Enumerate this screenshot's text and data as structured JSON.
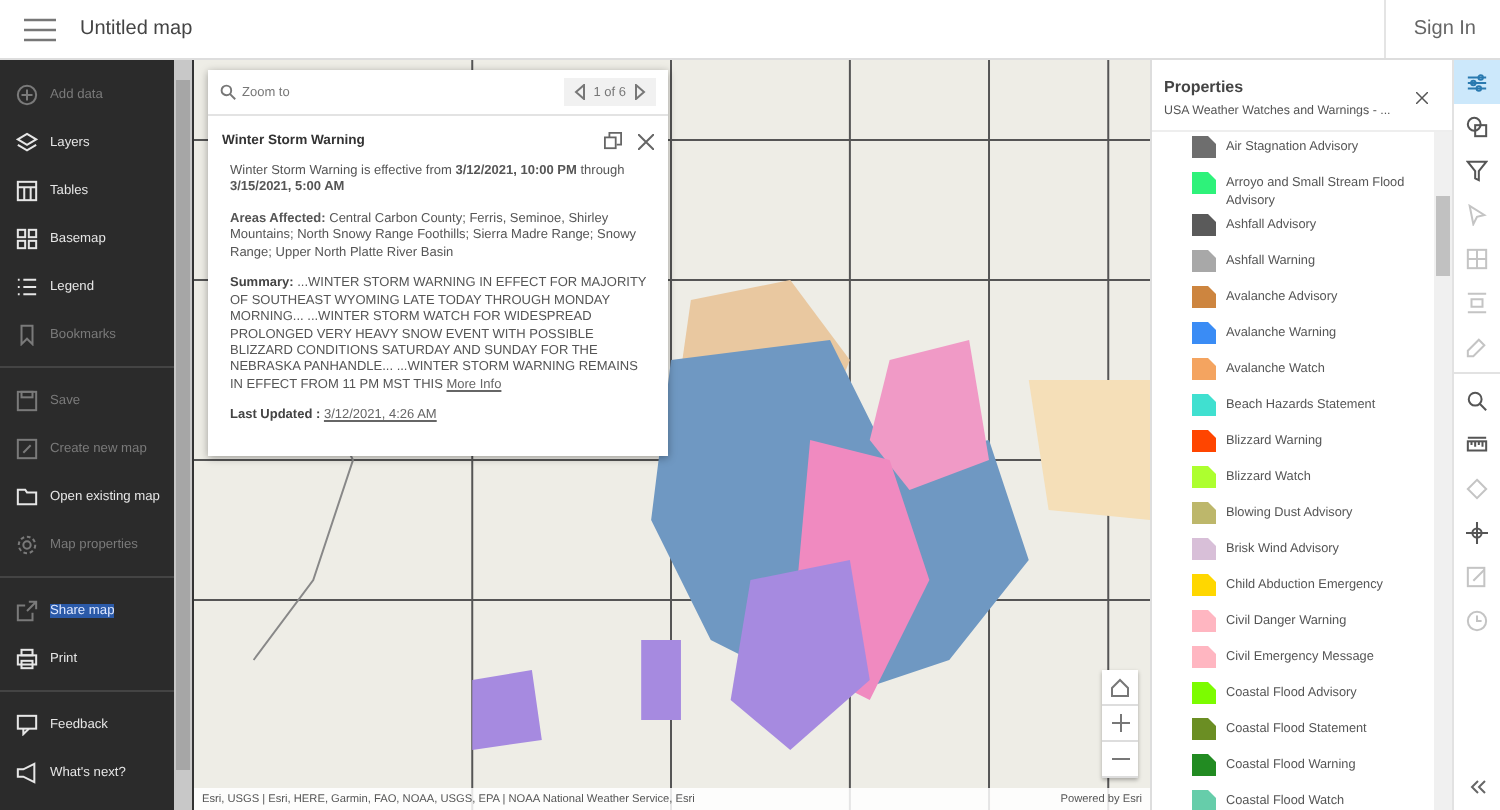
{
  "header": {
    "title": "Untitled map",
    "sign_in": "Sign In"
  },
  "sidebar": {
    "groups": [
      [
        {
          "label": "Add data",
          "kind": "plus-circle",
          "enabled": false,
          "highlighted": false
        },
        {
          "label": "Layers",
          "kind": "layers",
          "enabled": true,
          "highlighted": false
        },
        {
          "label": "Tables",
          "kind": "table",
          "enabled": true,
          "highlighted": false
        },
        {
          "label": "Basemap",
          "kind": "grid",
          "enabled": true,
          "highlighted": false
        },
        {
          "label": "Legend",
          "kind": "list",
          "enabled": true,
          "highlighted": false
        },
        {
          "label": "Bookmarks",
          "kind": "bookmark",
          "enabled": false,
          "highlighted": false
        }
      ],
      [
        {
          "label": "Save",
          "kind": "save",
          "enabled": false,
          "highlighted": false
        },
        {
          "label": "Create new map",
          "kind": "new",
          "enabled": false,
          "highlighted": false
        },
        {
          "label": "Open existing map",
          "kind": "folder",
          "enabled": true,
          "highlighted": false
        },
        {
          "label": "Map properties",
          "kind": "gear",
          "enabled": false,
          "highlighted": false
        }
      ],
      [
        {
          "label": "Share map",
          "kind": "share",
          "enabled": false,
          "highlighted": true
        },
        {
          "label": "Print",
          "kind": "print",
          "enabled": true,
          "highlighted": false
        }
      ],
      [
        {
          "label": "Feedback",
          "kind": "feedback",
          "enabled": true,
          "highlighted": false
        },
        {
          "label": "What's next?",
          "kind": "megaphone",
          "enabled": true,
          "highlighted": false
        }
      ]
    ]
  },
  "popup": {
    "zoom_to": "Zoom to",
    "pager": "1 of 6",
    "title": "Winter Storm Warning",
    "paragraphs": [
      "Winter Storm Warning is effective from **3/12/2021, 10:00 PM** through **3/15/2021, 5:00 AM**",
      "**Areas Affected:** Central Carbon County; Ferris, Seminoe, Shirley Mountains; North Snowy Range Foothills; Sierra Madre Range; Snowy Range; Upper North Platte River Basin"
    ],
    "summary_label": "Summary:",
    "summary": " ...WINTER STORM WARNING IN EFFECT FOR MAJORITY OF SOUTHEAST WYOMING LATE TODAY THROUGH MONDAY MORNING... ...WINTER STORM WATCH FOR WIDESPREAD PROLONGED VERY HEAVY SNOW EVENT WITH POSSIBLE BLIZZARD CONDITIONS SATURDAY AND SUNDAY FOR THE NEBRASKA PANHANDLE... ...WINTER STORM WARNING REMAINS IN EFFECT FROM 11 PM MST THIS ",
    "more_info": "More Info",
    "updated_label": "Last Updated :",
    "updated": "3/12/2021, 4:26 AM"
  },
  "map": {
    "attribution": "Esri, USGS | Esri, HERE, Garmin, FAO, NOAA, USGS, EPA | NOAA National Weather Service, Esri",
    "powered_by": "Powered by Esri"
  },
  "properties": {
    "title": "Properties",
    "subtitle": "USA Weather Watches and Warnings - ...",
    "legend": [
      {
        "label": "Air Stagnation Advisory",
        "color": "#6e6e6e"
      },
      {
        "label": "Arroyo and Small Stream Flood Advisory",
        "color": "#2ef27a"
      },
      {
        "label": "Ashfall Advisory",
        "color": "#5a5a5a"
      },
      {
        "label": "Ashfall Warning",
        "color": "#a8a8a8"
      },
      {
        "label": "Avalanche Advisory",
        "color": "#cd853f"
      },
      {
        "label": "Avalanche Warning",
        "color": "#3a8cf5"
      },
      {
        "label": "Avalanche Watch",
        "color": "#f4a460"
      },
      {
        "label": "Beach Hazards Statement",
        "color": "#40e0d0"
      },
      {
        "label": "Blizzard Warning",
        "color": "#ff4500"
      },
      {
        "label": "Blizzard Watch",
        "color": "#adff2f"
      },
      {
        "label": "Blowing Dust Advisory",
        "color": "#bdb76b"
      },
      {
        "label": "Brisk Wind Advisory",
        "color": "#d8bfd8"
      },
      {
        "label": "Child Abduction Emergency",
        "color": "#ffd700"
      },
      {
        "label": "Civil Danger Warning",
        "color": "#ffb6c1"
      },
      {
        "label": "Civil Emergency Message",
        "color": "#ffb6c1"
      },
      {
        "label": "Coastal Flood Advisory",
        "color": "#7cfc00"
      },
      {
        "label": "Coastal Flood Statement",
        "color": "#6b8e23"
      },
      {
        "label": "Coastal Flood Warning",
        "color": "#228b22"
      },
      {
        "label": "Coastal Flood Watch",
        "color": "#66cdaa"
      }
    ]
  },
  "toolbar": [
    {
      "kind": "sliders",
      "selected": true,
      "enabled": true
    },
    {
      "kind": "shapes",
      "selected": false,
      "enabled": true
    },
    {
      "kind": "filter",
      "selected": false,
      "enabled": true
    },
    {
      "kind": "cursor",
      "selected": false,
      "enabled": false
    },
    {
      "kind": "box",
      "selected": false,
      "enabled": false
    },
    {
      "kind": "align",
      "selected": false,
      "enabled": false
    },
    {
      "kind": "eraser",
      "selected": false,
      "enabled": false
    },
    {
      "kind": "search",
      "selected": false,
      "enabled": true
    },
    {
      "kind": "ruler",
      "selected": false,
      "enabled": true
    },
    {
      "kind": "diamond",
      "selected": false,
      "enabled": false
    },
    {
      "kind": "crosshair",
      "selected": false,
      "enabled": true
    },
    {
      "kind": "note",
      "selected": false,
      "enabled": false
    },
    {
      "kind": "clock",
      "selected": false,
      "enabled": false
    }
  ]
}
